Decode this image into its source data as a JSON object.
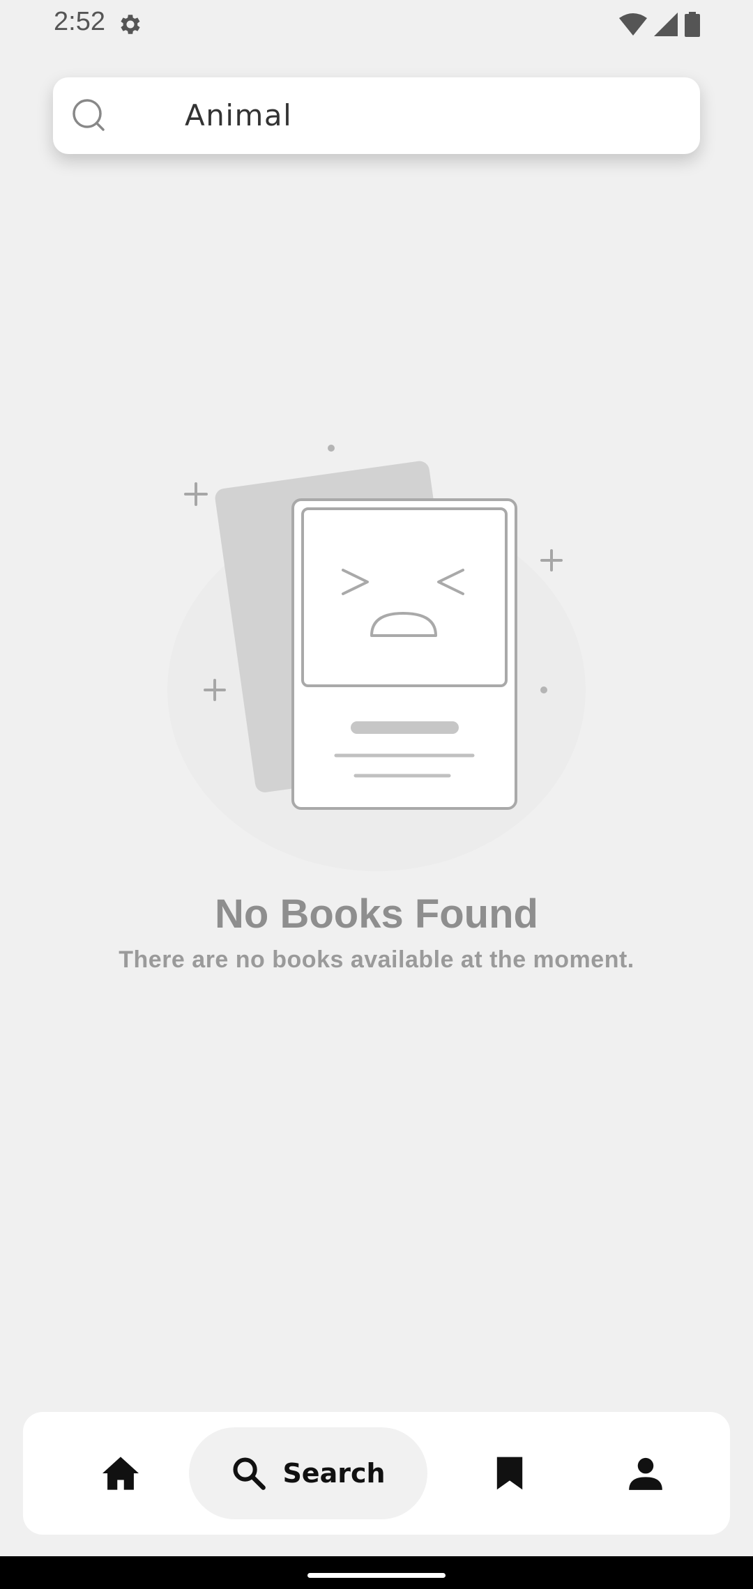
{
  "status_bar": {
    "time": "2:52",
    "icons": [
      "settings-gear-icon",
      "wifi-icon",
      "cellular-signal-icon",
      "battery-icon"
    ]
  },
  "search": {
    "query": "Animal",
    "icon": "search-icon"
  },
  "empty_state": {
    "illustration": "sad-book-cards-illustration",
    "title": "No Books Found",
    "subtitle": "There are no books available at the moment."
  },
  "bottom_nav": {
    "items": [
      {
        "id": "home",
        "icon": "home-icon",
        "label": "",
        "active": false
      },
      {
        "id": "search",
        "icon": "search-icon",
        "label": "Search",
        "active": true
      },
      {
        "id": "bookmarks",
        "icon": "bookmark-icon",
        "label": "",
        "active": false
      },
      {
        "id": "profile",
        "icon": "person-icon",
        "label": "",
        "active": false
      }
    ]
  },
  "colors": {
    "background": "#f0f0f0",
    "card": "#ffffff",
    "muted_text": "#8e8e8e",
    "active_nav_pill": "#f1f1f1"
  }
}
